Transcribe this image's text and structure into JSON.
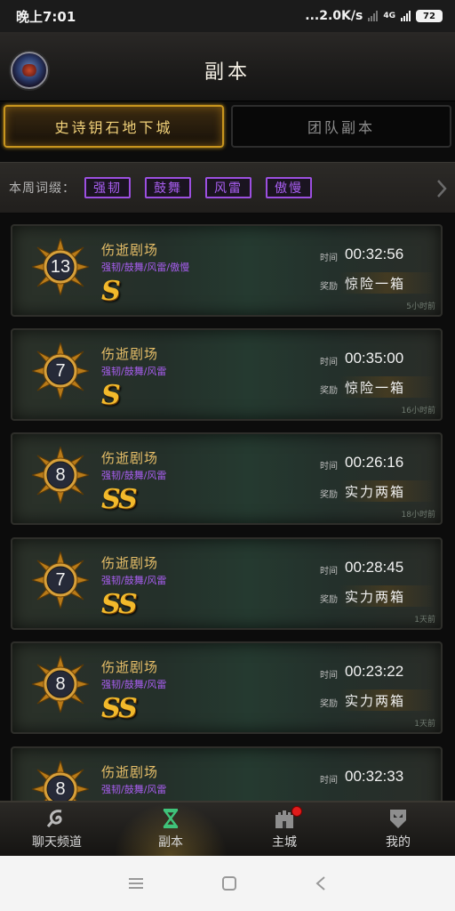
{
  "status_bar": {
    "time": "晚上7:01",
    "network_speed": "...2.0K/s",
    "network_type": "4G",
    "battery": "72"
  },
  "header": {
    "title": "副本"
  },
  "tabs": [
    {
      "label": "史诗钥石地下城",
      "active": true
    },
    {
      "label": "团队副本",
      "active": false
    }
  ],
  "affixes": {
    "label": "本周词缀：",
    "items": [
      "强韧",
      "鼓舞",
      "风雷",
      "傲慢"
    ]
  },
  "runs": [
    {
      "level": "13",
      "name": "伤逝剧场",
      "affixes": "强韧/鼓舞/风雷/傲慢",
      "grade": "S",
      "time_label": "时间",
      "time": "00:32:56",
      "reward_label": "奖励",
      "reward": "惊险一箱",
      "ago": "5小时前"
    },
    {
      "level": "7",
      "name": "伤逝剧场",
      "affixes": "强韧/鼓舞/风雷",
      "grade": "S",
      "time_label": "时间",
      "time": "00:35:00",
      "reward_label": "奖励",
      "reward": "惊险一箱",
      "ago": "16小时前"
    },
    {
      "level": "8",
      "name": "伤逝剧场",
      "affixes": "强韧/鼓舞/风雷",
      "grade": "SS",
      "time_label": "时间",
      "time": "00:26:16",
      "reward_label": "奖励",
      "reward": "实力两箱",
      "ago": "18小时前"
    },
    {
      "level": "7",
      "name": "伤逝剧场",
      "affixes": "强韧/鼓舞/风雷",
      "grade": "SS",
      "time_label": "时间",
      "time": "00:28:45",
      "reward_label": "奖励",
      "reward": "实力两箱",
      "ago": "1天前"
    },
    {
      "level": "8",
      "name": "伤逝剧场",
      "affixes": "强韧/鼓舞/风雷",
      "grade": "SS",
      "time_label": "时间",
      "time": "00:23:22",
      "reward_label": "奖励",
      "reward": "实力两箱",
      "ago": "1天前"
    },
    {
      "level": "8",
      "name": "伤逝剧场",
      "affixes": "强韧/鼓舞/风雷",
      "grade": "",
      "time_label": "时间",
      "time": "00:32:33",
      "reward_label": "",
      "reward": "",
      "ago": ""
    }
  ],
  "bottom_nav": [
    {
      "label": "聊天频道",
      "icon": "chat-icon",
      "active": false
    },
    {
      "label": "副本",
      "icon": "hourglass-icon",
      "active": true
    },
    {
      "label": "主城",
      "icon": "castle-icon",
      "active": false,
      "notification": true
    },
    {
      "label": "我的",
      "icon": "profile-icon",
      "active": false
    }
  ],
  "colors": {
    "accent_gold": "#c8951e",
    "affix_purple": "#a85ef0",
    "dungeon_name": "#e6be68",
    "grade_gold": "#f2b92b"
  }
}
